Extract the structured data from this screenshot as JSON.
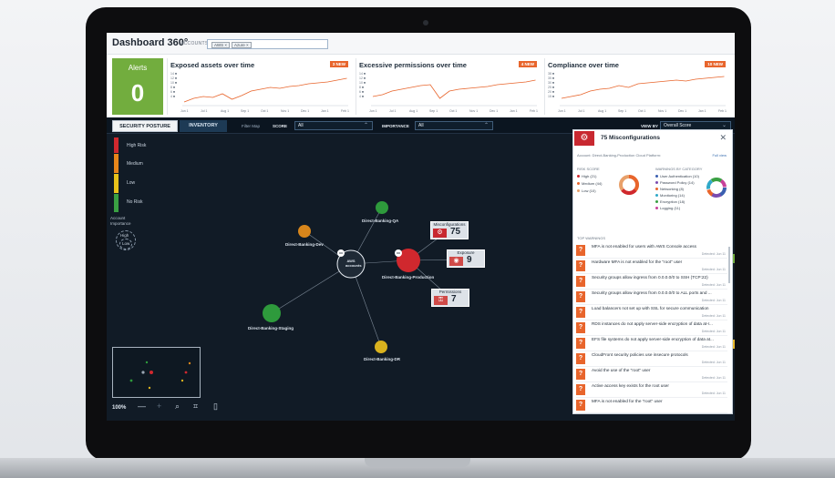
{
  "header": {
    "title": "Dashboard 360°",
    "accounts_label": "ACCOUNTS",
    "chips": [
      "AWS ×",
      "Azure ×"
    ]
  },
  "alerts": {
    "label": "Alerts",
    "count": "0"
  },
  "sparklines": [
    {
      "title": "Exposed assets over time",
      "badge": "3 NEW",
      "yticks": [
        "14 ■",
        "12 ■",
        "10 ■",
        "8 ■",
        "6 ■",
        "4 ■"
      ],
      "xticks": [
        "Jun 1",
        "Jul 1",
        "Aug 1",
        "Sep 1",
        "Oct 1",
        "Nov 1",
        "Dec 1",
        "Jan 1",
        "Feb 1"
      ]
    },
    {
      "title": "Excessive permissions over time",
      "badge": "4 NEW",
      "yticks": [
        "14 ■",
        "12 ■",
        "10 ■",
        "8 ■",
        "6 ■",
        "4 ■"
      ],
      "xticks": [
        "Jun 1",
        "Jul 1",
        "Aug 1",
        "Sep 1",
        "Oct 1",
        "Nov 1",
        "Dec 1",
        "Jan 1",
        "Feb 1"
      ]
    },
    {
      "title": "Compliance over time",
      "badge": "10 NEW",
      "yticks": [
        "38 ■",
        "35 ■",
        "30 ■",
        "25 ■",
        "20 ■",
        "15 ■"
      ],
      "xticks": [
        "Jun 1",
        "Jul 1",
        "Aug 1",
        "Sep 1",
        "Oct 1",
        "Nov 1",
        "Dec 1",
        "Jan 1",
        "Feb 1"
      ]
    }
  ],
  "toolbar": {
    "tab_security": "SECURITY POSTURE",
    "tab_inventory": "INVENTORY",
    "filter_map": "Filter Map",
    "score_label": "SCORE",
    "score_value": "All",
    "importance_label": "IMPORTANCE",
    "importance_value": "All",
    "viewby_label": "VIEW BY",
    "viewby_value": "Overall Score"
  },
  "legend": {
    "items": [
      {
        "label": "High Risk",
        "color": "#d0282e"
      },
      {
        "label": "Medium",
        "color": "#e8861a"
      },
      {
        "label": "Low",
        "color": "#e8c21a"
      },
      {
        "label": "No Risk",
        "color": "#3aa043"
      }
    ],
    "importance_title": "Account\nImportance",
    "importance_high": "High",
    "importance_low": "Low"
  },
  "graph": {
    "center": "AWS\naccounts",
    "nodes": [
      {
        "label": "Direct-Banking-QA",
        "color": "#2e9a3c"
      },
      {
        "label": "Direct-Banking-Dev",
        "color": "#d8861b"
      },
      {
        "label": "Direct-Banking-Production",
        "color": "#d0282e"
      },
      {
        "label": "Direct-Banking-Staging",
        "color": "#2e9a3c"
      },
      {
        "label": "Direct-Banking-DR",
        "color": "#d9b21e"
      }
    ],
    "cards": [
      {
        "title": "Misconfigurations",
        "value": "75",
        "icon": "⚙"
      },
      {
        "title": "Exposure",
        "value": "9",
        "icon": "◉"
      },
      {
        "title": "Permissions",
        "value": "7",
        "icon": "⚿"
      }
    ]
  },
  "zoom": {
    "level": "100%"
  },
  "panel": {
    "title": "75 Misconfigurations",
    "meta": "Account: Direct-Banking-Production   Cloud Platform:",
    "link": "Full view",
    "risk_title": "RISK SCORE",
    "risk": [
      {
        "label": "High (21)",
        "color": "#d0282e"
      },
      {
        "label": "Medium (44)",
        "color": "#e8652c"
      },
      {
        "label": "Low (10)",
        "color": "#e8a06a"
      }
    ],
    "cat_title": "WARNINGS BY CATEGORY",
    "categories": [
      {
        "label": "User Authentication (10)",
        "color": "#3b5fb0"
      },
      {
        "label": "Password Policy (14)",
        "color": "#7a4cb0"
      },
      {
        "label": "Networking (8)",
        "color": "#e8652c"
      },
      {
        "label": "Monitoring (14)",
        "color": "#2fa8c8"
      },
      {
        "label": "Encryption (18)",
        "color": "#3aa043"
      },
      {
        "label": "Logging (11)",
        "color": "#c8409a"
      }
    ],
    "warnings_title": "TOP WARNINGS",
    "warnings": [
      {
        "text": "MFA is not enabled for users with AWS Console access",
        "date": "Detected: Jun 11"
      },
      {
        "text": "Hardware MFA is not enabled for the \"root\" user",
        "date": "Detected: Jun 11"
      },
      {
        "text": "Security groups allow ingress from 0.0.0.0/0 to SSH (TCP:22)",
        "date": "Detected: Jun 11"
      },
      {
        "text": "Security groups allow ingress from 0.0.0.0/0 to ALL ports and ...",
        "date": "Detected: Jun 11"
      },
      {
        "text": "Load balancers not set up with SSL for secure communication",
        "date": "Detected: Jun 11"
      },
      {
        "text": "RDS instances do not apply server-side encryption of data at-r...",
        "date": "Detected: Jun 11"
      },
      {
        "text": "EFS file systems do not apply server-side encryption of data at...",
        "date": "Detected: Jun 11"
      },
      {
        "text": "CloudFront security policies use insecure protocols",
        "date": "Detected: Jun 11"
      },
      {
        "text": "Avoid the use of the \"root\" user",
        "date": "Detected: Jun 11"
      },
      {
        "text": "Active access key exists for the root user",
        "date": "Detected: Jun 11"
      },
      {
        "text": "MFA is not enabled for the \"root\" user",
        "date": ""
      }
    ]
  }
}
